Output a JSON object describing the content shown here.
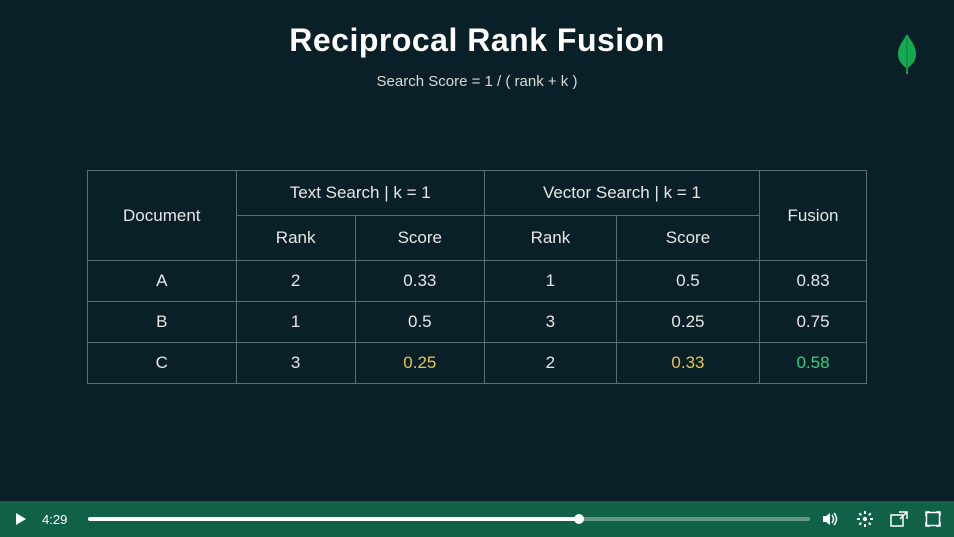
{
  "slide": {
    "title": "Reciprocal Rank Fusion",
    "subtitle": "Search Score = 1 / ( rank + k )"
  },
  "table": {
    "headers": {
      "document": "Document",
      "text_group": "Text Search | k = 1",
      "vector_group": "Vector Search | k = 1",
      "fusion": "Fusion",
      "rank": "Rank",
      "score": "Score"
    },
    "rows": [
      {
        "doc": "A",
        "t_rank": "2",
        "t_score": "0.33",
        "v_rank": "1",
        "v_score": "0.5",
        "fusion": "0.83",
        "hl": ""
      },
      {
        "doc": "B",
        "t_rank": "1",
        "t_score": "0.5",
        "v_rank": "3",
        "v_score": "0.25",
        "fusion": "0.75",
        "hl": ""
      },
      {
        "doc": "C",
        "t_rank": "3",
        "t_score": "0.25",
        "v_rank": "2",
        "v_score": "0.33",
        "fusion": "0.58",
        "hl": "yellow-green"
      }
    ]
  },
  "player": {
    "time": "4:29",
    "progress_pct": 68
  },
  "chart_data": {
    "type": "table",
    "title": "Reciprocal Rank Fusion",
    "formula": "Search Score = 1 / ( rank + k )",
    "k_text": 1,
    "k_vector": 1,
    "columns": [
      "Document",
      "Text Rank",
      "Text Score",
      "Vector Rank",
      "Vector Score",
      "Fusion"
    ],
    "data": [
      {
        "Document": "A",
        "TextRank": 2,
        "TextScore": 0.33,
        "VectorRank": 1,
        "VectorScore": 0.5,
        "Fusion": 0.83
      },
      {
        "Document": "B",
        "TextRank": 1,
        "TextScore": 0.5,
        "VectorRank": 3,
        "VectorScore": 0.25,
        "Fusion": 0.75
      },
      {
        "Document": "C",
        "TextRank": 3,
        "TextScore": 0.25,
        "VectorRank": 2,
        "VectorScore": 0.33,
        "Fusion": 0.58
      }
    ]
  }
}
